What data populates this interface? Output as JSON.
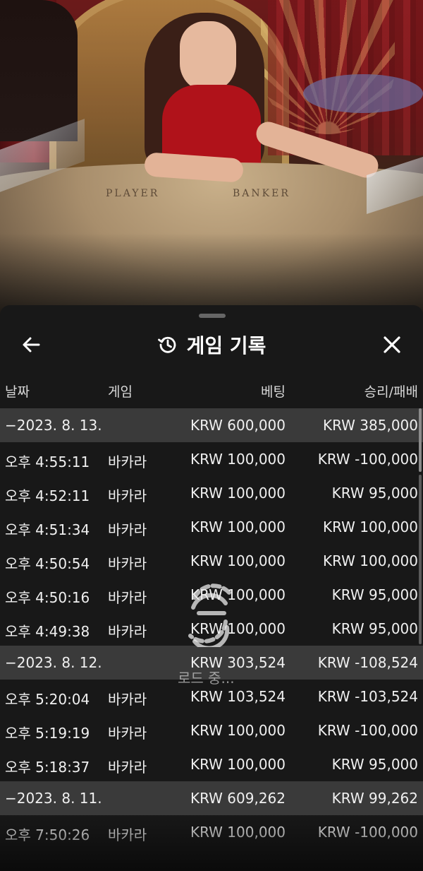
{
  "video": {
    "table_labels": [
      "PLAYER",
      "BANKER"
    ]
  },
  "sheet": {
    "title": "게임 기록",
    "back_icon": "arrow-left-icon",
    "history_icon": "history-icon",
    "close_icon": "close-icon",
    "columns": {
      "date": "날짜",
      "game": "게임",
      "bet": "베팅",
      "result": "승리/패배"
    },
    "groups": [
      {
        "date": "−2023. 8. 13.",
        "bet": "KRW 600,000",
        "result": "KRW 385,000",
        "items": [
          {
            "time": "오후 4:55:11",
            "game": "바카라",
            "bet": "KRW 100,000",
            "result": "KRW -100,000"
          },
          {
            "time": "오후 4:52:11",
            "game": "바카라",
            "bet": "KRW 100,000",
            "result": "KRW 95,000"
          },
          {
            "time": "오후 4:51:34",
            "game": "바카라",
            "bet": "KRW 100,000",
            "result": "KRW 100,000"
          },
          {
            "time": "오후 4:50:54",
            "game": "바카라",
            "bet": "KRW 100,000",
            "result": "KRW 100,000"
          },
          {
            "time": "오후 4:50:16",
            "game": "바카라",
            "bet": "KRW 100,000",
            "result": "KRW 95,000"
          },
          {
            "time": "오후 4:49:38",
            "game": "바카라",
            "bet": "KRW 100,000",
            "result": "KRW 95,000"
          }
        ]
      },
      {
        "date": "−2023. 8. 12.",
        "bet": "KRW 303,524",
        "result": "KRW -108,524",
        "items": [
          {
            "time": "오후 5:20:04",
            "game": "바카라",
            "bet": "KRW 103,524",
            "result": "KRW -103,524"
          },
          {
            "time": "오후 5:19:19",
            "game": "바카라",
            "bet": "KRW 100,000",
            "result": "KRW -100,000"
          },
          {
            "time": "오후 5:18:37",
            "game": "바카라",
            "bet": "KRW 100,000",
            "result": "KRW 95,000"
          }
        ]
      },
      {
        "date": "−2023. 8. 11.",
        "bet": "KRW 609,262",
        "result": "KRW 99,262",
        "items": [
          {
            "time": "오후 7:50:26",
            "game": "바카라",
            "bet": "KRW 100,000",
            "result": "KRW -100,000"
          }
        ]
      }
    ]
  },
  "overlay": {
    "loading_text": "로드 중...",
    "spinner_icon": "loading-spinner-icon"
  }
}
